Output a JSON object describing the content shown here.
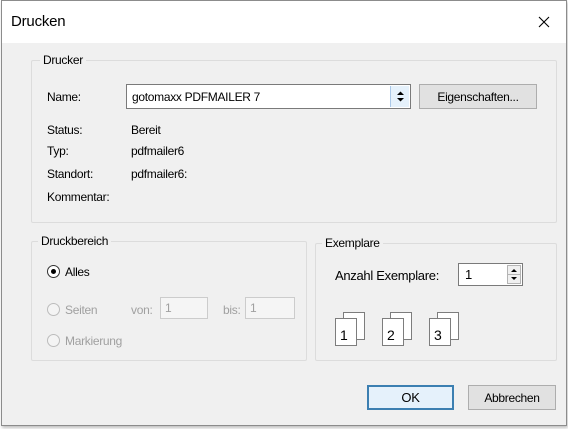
{
  "window": {
    "title": "Drucken",
    "close_icon": "close-icon"
  },
  "printer": {
    "legend": "Drucker",
    "name_label": "Name:",
    "name_value": "gotomaxx PDFMAILER 7",
    "properties_button": "Eigenschaften...",
    "status_label": "Status:",
    "status_value": "Bereit",
    "type_label": "Typ:",
    "type_value": "pdfmailer6",
    "location_label": "Standort:",
    "location_value": "pdfmailer6:",
    "comment_label": "Kommentar:",
    "comment_value": ""
  },
  "range": {
    "legend": "Druckbereich",
    "all_label": "Alles",
    "all_selected": true,
    "pages_label": "Seiten",
    "from_label": "von:",
    "from_value": "1",
    "to_label": "bis:",
    "to_value": "1",
    "selection_label": "Markierung"
  },
  "copies": {
    "legend": "Exemplare",
    "count_label": "Anzahl Exemplare:",
    "count_value": "1",
    "collate_pages": [
      {
        "front": "1",
        "back": "1"
      },
      {
        "front": "2",
        "back": "2"
      },
      {
        "front": "3",
        "back": "3"
      }
    ]
  },
  "buttons": {
    "ok": "OK",
    "cancel": "Abbrechen"
  },
  "colors": {
    "dialog_bg": "#f0f0f0",
    "default_button_border": "#3c7fb1",
    "disabled_text": "#a0a0a0"
  }
}
